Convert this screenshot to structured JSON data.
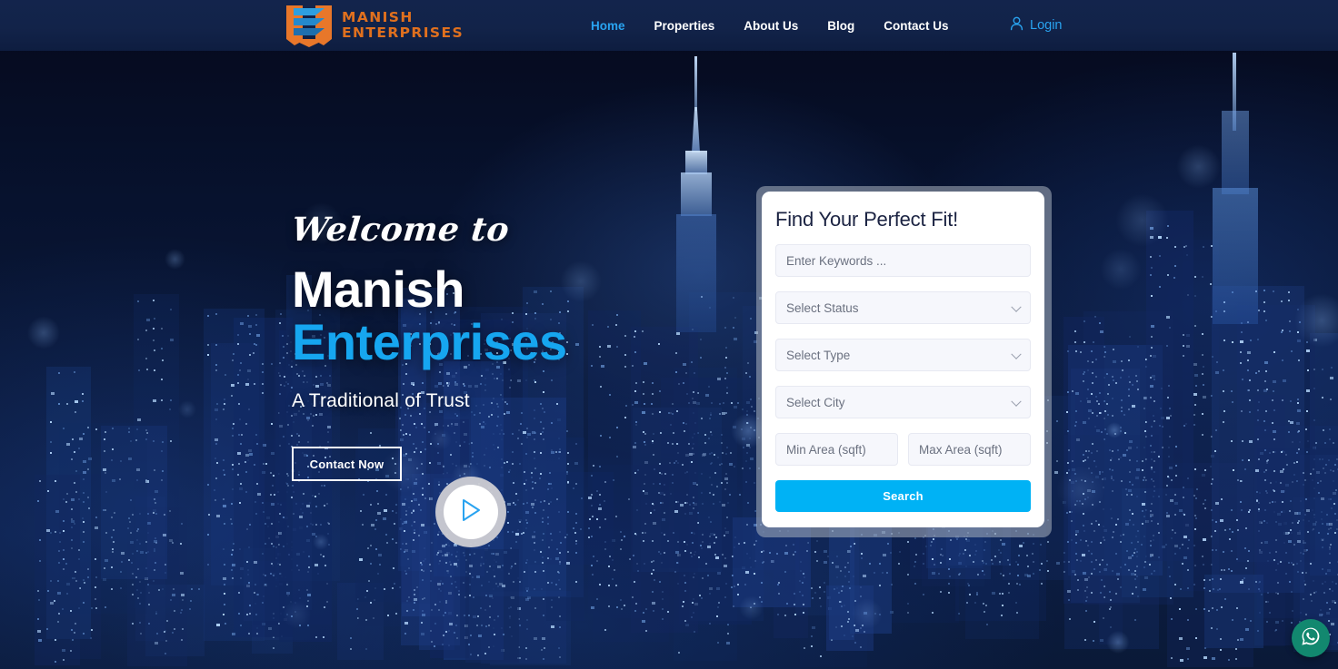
{
  "header": {
    "brand": {
      "logo_icon": "shield-chevron-logo-icon",
      "line1": "MANISH",
      "line2": "ENTERPRISES",
      "color": "#e0701e"
    },
    "nav": [
      {
        "label": "Home",
        "active": true
      },
      {
        "label": "Properties",
        "active": false
      },
      {
        "label": "About Us",
        "active": false
      },
      {
        "label": "Blog",
        "active": false
      },
      {
        "label": "Contact Us",
        "active": false
      }
    ],
    "login": {
      "label": "Login",
      "icon": "user-icon",
      "color": "#29a3f0"
    },
    "background_color": "#13244c"
  },
  "hero": {
    "welcome": "Welcome to",
    "title_line1": "Manish",
    "title_line2": "Enterprises",
    "title_line2_color": "#16a6f0",
    "subtitle": "A Traditional of Trust",
    "cta_label": "Contact Now",
    "play_icon": "play-triangle-icon",
    "background": "night-city-skyline"
  },
  "search_card": {
    "title": "Find Your Perfect Fit!",
    "keywords_placeholder": "Enter Keywords ...",
    "status_label": "Select Status",
    "type_label": "Select Type",
    "city_label": "Select City",
    "min_area_placeholder": "Min Area (sqft)",
    "max_area_placeholder": "Max Area (sqft)",
    "search_label": "Search",
    "search_button_color": "#00b2f5",
    "chevron_icon": "chevron-down-icon"
  },
  "floating": {
    "whatsapp_icon": "whatsapp-icon",
    "whatsapp_color": "#12886f"
  }
}
